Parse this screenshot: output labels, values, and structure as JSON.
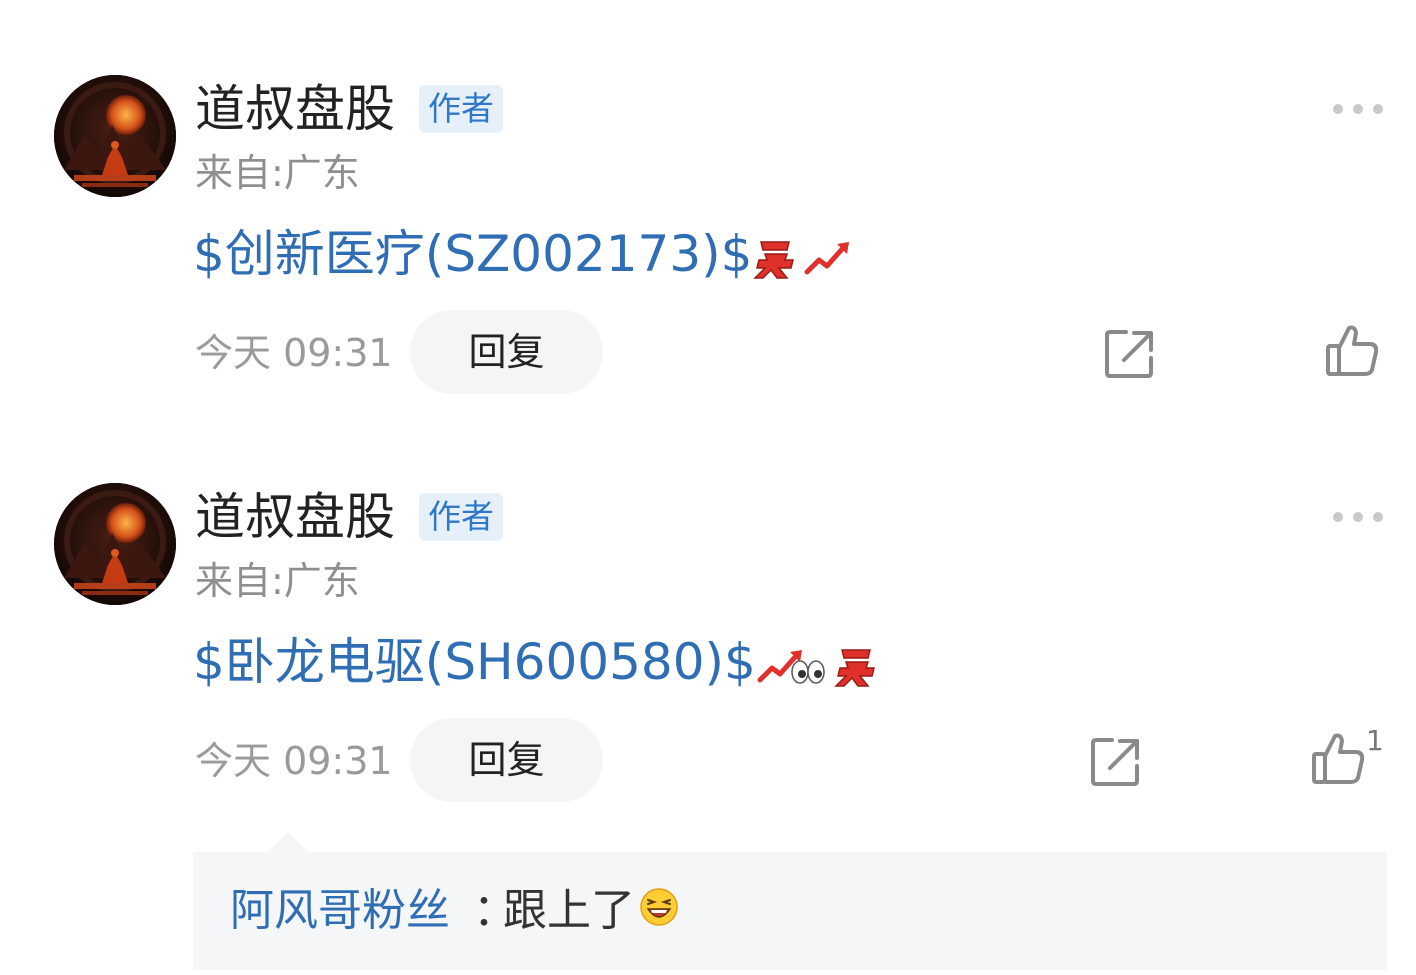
{
  "colors": {
    "link_blue": "#2f6db5",
    "badge_bg": "#e6f0fb",
    "badge_text": "#2e78c6",
    "meta_gray": "#9a9a9a",
    "reply_bg": "#f4f5f7",
    "emoji_red": "#e0302b"
  },
  "posts": [
    {
      "author": "道叔盘股",
      "badge": "作者",
      "location": "来自:广东",
      "content": "$创新医疗(SZ002173)$",
      "emojis": [
        "buy-emoji",
        "trend-up-emoji"
      ],
      "time": "今天 09:31",
      "reply_label": "回复",
      "like_count": ""
    },
    {
      "author": "道叔盘股",
      "badge": "作者",
      "location": "来自:广东",
      "content": "$卧龙电驱(SH600580)$",
      "emojis": [
        "trend-up-emoji",
        "eyes-emoji",
        "buy-emoji"
      ],
      "time": "今天 09:31",
      "reply_label": "回复",
      "like_count": "1"
    }
  ],
  "sub_reply": {
    "user": "阿风哥粉丝",
    "separator": "：",
    "text": "跟上了",
    "emoji": "laughing-face-emoji"
  }
}
